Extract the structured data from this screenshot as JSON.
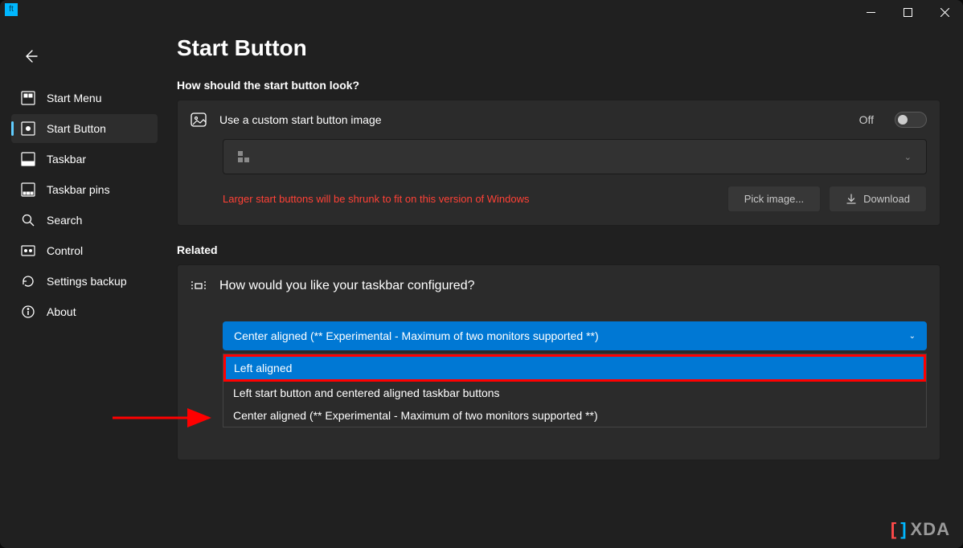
{
  "titlebar": {
    "app_icon_label": "ft"
  },
  "sidebar": {
    "items": [
      {
        "label": "Start Menu"
      },
      {
        "label": "Start Button"
      },
      {
        "label": "Taskbar"
      },
      {
        "label": "Taskbar pins"
      },
      {
        "label": "Search"
      },
      {
        "label": "Control"
      },
      {
        "label": "Settings backup"
      },
      {
        "label": "About"
      }
    ]
  },
  "main": {
    "title": "Start Button",
    "look_section_label": "How should the start button look?",
    "custom_image_label": "Use a custom start button image",
    "toggle_state": "Off",
    "warning": "Larger start buttons will be shrunk to fit on this version of Windows",
    "pick_image_label": "Pick image...",
    "download_label": "Download",
    "related_label": "Related",
    "taskbar_config_label": "How would you like your taskbar configured?",
    "dropdown_selected": "Center aligned (** Experimental - Maximum of two monitors supported **)",
    "dropdown_options": [
      "Left aligned",
      "Left start button and centered aligned taskbar buttons",
      "Center aligned (** Experimental - Maximum of two monitors supported **)"
    ]
  },
  "watermark": {
    "text": "XDA"
  }
}
